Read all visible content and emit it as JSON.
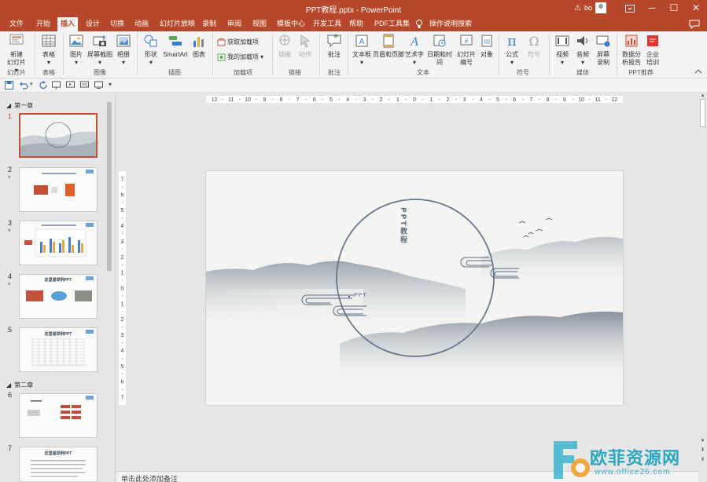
{
  "window": {
    "title": "PPT教程.pptx  -  PowerPoint",
    "user": "bo",
    "minimize": "─",
    "maximize": "☐",
    "close": "✕"
  },
  "tabs": [
    {
      "label": "文件"
    },
    {
      "label": "开始"
    },
    {
      "label": "插入",
      "active": true
    },
    {
      "label": "设计"
    },
    {
      "label": "切换"
    },
    {
      "label": "动画"
    },
    {
      "label": "幻灯片放映"
    },
    {
      "label": "录制"
    },
    {
      "label": "审阅"
    },
    {
      "label": "视图"
    },
    {
      "label": "模板中心"
    },
    {
      "label": "开发工具"
    },
    {
      "label": "帮助"
    },
    {
      "label": "PDF工具集"
    },
    {
      "label": "操作说明搜索"
    }
  ],
  "ribbon": {
    "new_slide_1": "新建",
    "new_slide_2": "幻灯片",
    "table": "表格",
    "picture": "图片",
    "screenshot": "屏幕截图",
    "album": "相册",
    "shape": "形状",
    "smartart": "SmartArt",
    "chart": "图表",
    "get_addins": "获取加载项",
    "my_addins": "我的加载项",
    "link": "链接",
    "action": "动作",
    "comment": "批注",
    "textbox": "文本框",
    "header_footer": "页眉和页脚",
    "wordart": "艺术字",
    "datetime": "日期和时间",
    "slide_number_1": "幻灯片",
    "slide_number_2": "编号",
    "object": "对象",
    "equation": "公式",
    "symbol": "符号",
    "video": "视频",
    "audio": "音频",
    "screen_rec_1": "屏幕",
    "screen_rec_2": "录制",
    "data_report_1": "数据分",
    "data_report_2": "析报告",
    "training_1": "企业",
    "training_2": "培训",
    "groups": {
      "slides": "幻灯片",
      "tables": "表格",
      "images": "图像",
      "illustrations": "插图",
      "addins": "加载项",
      "links": "链接",
      "comments": "批注",
      "text": "文本",
      "symbols": "符号",
      "media": "媒体",
      "ppt_recommend": "PPT推荐"
    }
  },
  "sections": {
    "chapter1": "第一章",
    "chapter2": "第二章"
  },
  "slides": [
    {
      "num": "1"
    },
    {
      "num": "2",
      "star": "*"
    },
    {
      "num": "3",
      "star": "*"
    },
    {
      "num": "4",
      "star": "*"
    },
    {
      "num": "5"
    },
    {
      "num": "6"
    },
    {
      "num": "7"
    }
  ],
  "thumb_text": {
    "s4_title": "这里是举例PPT",
    "s5_title": "这里是举例PPT",
    "s7_title": "这里是举例PPT"
  },
  "ruler": {
    "h_ticks": [
      "12",
      "11",
      "10",
      "9",
      "8",
      "7",
      "6",
      "5",
      "4",
      "3",
      "2",
      "1",
      "0",
      "1",
      "2",
      "3",
      "4",
      "5",
      "6",
      "7",
      "8",
      "9",
      "10",
      "11",
      "12"
    ],
    "v_ticks": [
      "7",
      "6",
      "5",
      "4",
      "3",
      "2",
      "1",
      "0",
      "1",
      "2",
      "3",
      "4",
      "5",
      "6",
      "7"
    ]
  },
  "slide_main": {
    "vertical_title": "PPT教程",
    "bullet_label": "PPT"
  },
  "notes_placeholder": "单击此处添加备注",
  "watermark": {
    "brand": "欧菲资源网",
    "url": "www.office26.com"
  },
  "colors": {
    "accent": "#b7472a",
    "ink": "#5a6b82",
    "circle": "#66798f"
  }
}
